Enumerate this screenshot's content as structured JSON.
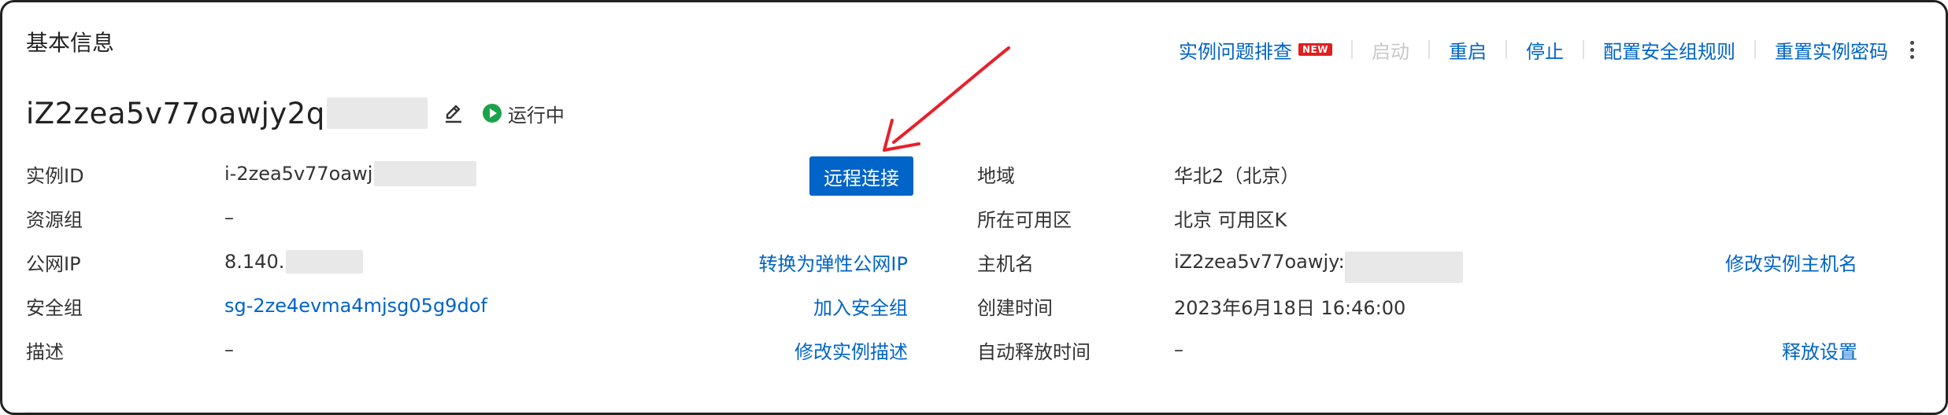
{
  "section": {
    "title": "基本信息"
  },
  "actions": {
    "troubleshoot": "实例问题排查",
    "new_badge": "NEW",
    "start": "启动",
    "restart": "重启",
    "stop": "停止",
    "config_sg_rules": "配置安全组规则",
    "reset_password": "重置实例密码"
  },
  "instance": {
    "name": "iZ2zea5v77oawjy2q",
    "status": "运行中"
  },
  "fields": {
    "instance_id": {
      "label": "实例ID",
      "value": "i-2zea5v77oawj"
    },
    "resource_group": {
      "label": "资源组",
      "value": "–"
    },
    "public_ip": {
      "label": "公网IP",
      "value": "8.140.",
      "action": "转换为弹性公网IP"
    },
    "security_group": {
      "label": "安全组",
      "value": "sg-2ze4evma4mjsg05g9dof",
      "action": "加入安全组"
    },
    "description": {
      "label": "描述",
      "value": "–",
      "action": "修改实例描述"
    },
    "region": {
      "label": "地域",
      "value": "华北2（北京）"
    },
    "zone": {
      "label": "所在可用区",
      "value": "北京 可用区K"
    },
    "hostname": {
      "label": "主机名",
      "value": "iZ2zea5v77oawjy:",
      "action": "修改实例主机名"
    },
    "created": {
      "label": "创建时间",
      "value": "2023年6月18日 16:46:00"
    },
    "auto_release": {
      "label": "自动释放时间",
      "value": "–",
      "action": "释放设置"
    }
  },
  "remote_connect": {
    "label": "远程连接"
  },
  "colors": {
    "link": "#0064c8",
    "primary_button": "#0064c8",
    "running": "#1aa34a",
    "new_badge": "#e02020",
    "annotation_arrow": "#e8202a"
  },
  "icons": {
    "edit": "pencil-icon",
    "status": "play-circle-icon",
    "more": "more-vertical-icon",
    "annotation": "red-arrow"
  }
}
